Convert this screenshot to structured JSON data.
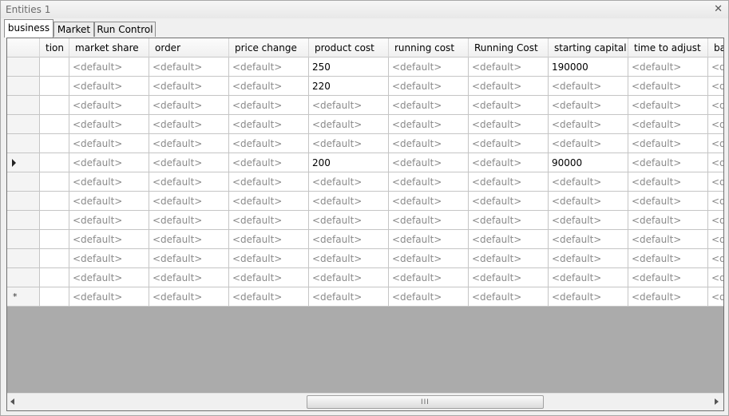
{
  "window": {
    "title": "Entities 1"
  },
  "tabs": [
    {
      "label": "business",
      "active": true
    },
    {
      "label": "Market",
      "active": false
    },
    {
      "label": "Run Control",
      "active": false
    }
  ],
  "grid": {
    "columns": [
      "tion",
      "market share",
      "order",
      "price change",
      "product cost",
      "running cost",
      "Running Cost",
      "starting capital",
      "time to adjust",
      "ba"
    ],
    "default_text": "<default>",
    "row_markers": [
      "",
      "",
      "",
      "",
      "",
      "current",
      "",
      "",
      "",
      "",
      "",
      "",
      "new"
    ],
    "rows": [
      [
        "",
        "<default>",
        "<default>",
        "<default>",
        "250",
        "<default>",
        "<default>",
        "190000",
        "<default>",
        "<default>"
      ],
      [
        "",
        "<default>",
        "<default>",
        "<default>",
        "220",
        "<default>",
        "<default>",
        "<default>",
        "<default>",
        "<default>"
      ],
      [
        "",
        "<default>",
        "<default>",
        "<default>",
        "<default>",
        "<default>",
        "<default>",
        "<default>",
        "<default>",
        "<default>"
      ],
      [
        "",
        "<default>",
        "<default>",
        "<default>",
        "<default>",
        "<default>",
        "<default>",
        "<default>",
        "<default>",
        "<default>"
      ],
      [
        "",
        "<default>",
        "<default>",
        "<default>",
        "<default>",
        "<default>",
        "<default>",
        "<default>",
        "<default>",
        "<default>"
      ],
      [
        "",
        "<default>",
        "<default>",
        "<default>",
        "200",
        "<default>",
        "<default>",
        "90000",
        "<default>",
        "<default>"
      ],
      [
        "",
        "<default>",
        "<default>",
        "<default>",
        "<default>",
        "<default>",
        "<default>",
        "<default>",
        "<default>",
        "<default>"
      ],
      [
        "",
        "<default>",
        "<default>",
        "<default>",
        "<default>",
        "<default>",
        "<default>",
        "<default>",
        "<default>",
        "<default>"
      ],
      [
        "",
        "<default>",
        "<default>",
        "<default>",
        "<default>",
        "<default>",
        "<default>",
        "<default>",
        "<default>",
        "<default>"
      ],
      [
        "",
        "<default>",
        "<default>",
        "<default>",
        "<default>",
        "<default>",
        "<default>",
        "<default>",
        "<default>",
        "<default>"
      ],
      [
        "",
        "<default>",
        "<default>",
        "<default>",
        "<default>",
        "<default>",
        "<default>",
        "<default>",
        "<default>",
        "<default>"
      ],
      [
        "",
        "<default>",
        "<default>",
        "<default>",
        "<default>",
        "<default>",
        "<default>",
        "<default>",
        "<default>",
        "<default>"
      ],
      [
        "",
        "<default>",
        "<default>",
        "<default>",
        "<default>",
        "<default>",
        "<default>",
        "<default>",
        "<default>",
        "<default>"
      ]
    ]
  },
  "scrollbar": {
    "grip": "III"
  }
}
